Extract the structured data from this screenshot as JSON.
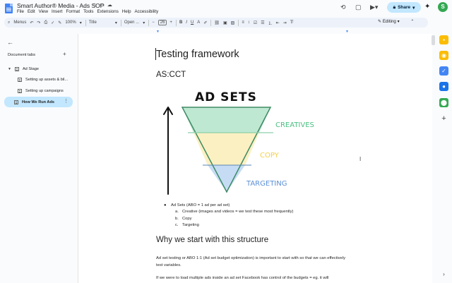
{
  "app": {
    "doc_title": "Smart Author® Media - Ads SOP",
    "menu": [
      "File",
      "Edit",
      "View",
      "Insert",
      "Format",
      "Tools",
      "Extensions",
      "Help",
      "Accessibility"
    ],
    "share_label": "Share",
    "avatar_letter": "S",
    "editing_label": "Editing"
  },
  "toolbar": {
    "menus_label": "Menus",
    "zoom": "100%",
    "style": "Title",
    "font": "Open ...",
    "font_size": "26"
  },
  "sidebar": {
    "heading": "Document tabs",
    "tabs": [
      {
        "label": "Ad Stage"
      },
      {
        "label": "Setting up assets & bil..."
      },
      {
        "label": "Setting up campaigns"
      },
      {
        "label": "How We Run Ads"
      }
    ]
  },
  "document": {
    "title": "Testing framework",
    "subtitle": "AS:CCT",
    "drawing": {
      "heading": "AD SETS",
      "labels": [
        "CREATIVES",
        "COPY",
        "TARGETING"
      ],
      "colors": {
        "creatives": "#bfe8d2",
        "copy": "#fbf0c2",
        "targeting": "#c6dcf5",
        "creatives_text": "#4cbf83",
        "copy_text": "#f3d04a",
        "targeting_text": "#5b8fd6"
      }
    },
    "bullet": "Ad Sets (ABO = 1 ad per ad set)",
    "sub_items": [
      {
        "marker": "a.",
        "text": "Creative (images and videos = we test these most frequently)"
      },
      {
        "marker": "b.",
        "text": "Copy"
      },
      {
        "marker": "c.",
        "text": "Targeting"
      }
    ],
    "section_heading": "Why we start with this structure",
    "para1": "Ad set testing or ABO 1:1 (Ad set budget optimization) is important to start with so that we can effectively test variables.",
    "para2": "If we were to load multiple ads inside an ad set Facebook has control of the budgets = eg. it will"
  }
}
